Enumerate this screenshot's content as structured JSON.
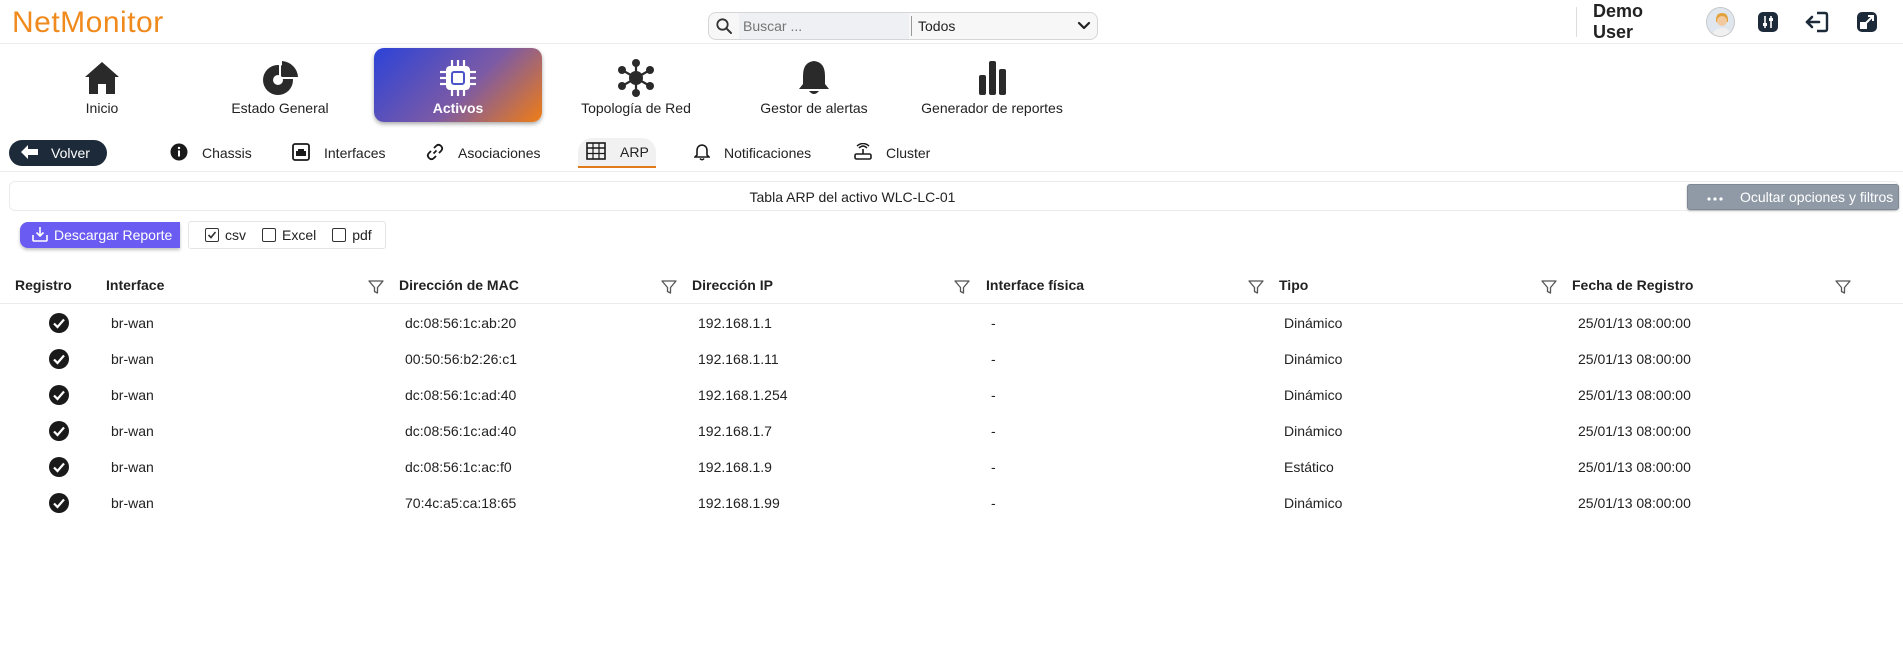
{
  "app": {
    "logo": "NetMonitor"
  },
  "search": {
    "placeholder": "Buscar ...",
    "scope_selected": "Todos"
  },
  "user": {
    "name": "Demo User"
  },
  "modules": [
    {
      "label": "Inicio",
      "icon": "home-icon"
    },
    {
      "label": "Estado General",
      "icon": "pie-chart-icon"
    },
    {
      "label": "Activos",
      "icon": "chip-icon",
      "active": true
    },
    {
      "label": "Topología de Red",
      "icon": "network-topology-icon"
    },
    {
      "label": "Gestor de alertas",
      "icon": "bell-icon"
    },
    {
      "label": "Generador de reportes",
      "icon": "bar-chart-icon"
    }
  ],
  "subnav": {
    "back_label": "Volver",
    "tabs": [
      {
        "label": "Chassis",
        "icon": "info-icon"
      },
      {
        "label": "Interfaces",
        "icon": "interface-icon"
      },
      {
        "label": "Asociaciones",
        "icon": "link-icon"
      },
      {
        "label": "ARP",
        "icon": "table-icon",
        "active": true
      },
      {
        "label": "Notificaciones",
        "icon": "bell-icon"
      },
      {
        "label": "Cluster",
        "icon": "router-icon"
      }
    ]
  },
  "panel": {
    "title": "Tabla ARP del activo WLC-LC-01",
    "toggle_label": "Ocultar opciones y filtros"
  },
  "report": {
    "download_label": "Descargar Reporte",
    "formats": [
      {
        "label": "csv",
        "checked": true
      },
      {
        "label": "Excel",
        "checked": false
      },
      {
        "label": "pdf",
        "checked": false
      }
    ]
  },
  "table": {
    "headers": [
      "Registro",
      "Interface",
      "Dirección de MAC",
      "Dirección IP",
      "Interface física",
      "Tipo",
      "Fecha de Registro"
    ],
    "rows": [
      {
        "interface": "br-wan",
        "mac": "dc:08:56:1c:ab:20",
        "ip": "192.168.1.1",
        "physical": "-",
        "type": "Dinámico",
        "date": "25/01/13 08:00:00"
      },
      {
        "interface": "br-wan",
        "mac": "00:50:56:b2:26:c1",
        "ip": "192.168.1.11",
        "physical": "-",
        "type": "Dinámico",
        "date": "25/01/13 08:00:00"
      },
      {
        "interface": "br-wan",
        "mac": "dc:08:56:1c:ad:40",
        "ip": "192.168.1.254",
        "physical": "-",
        "type": "Dinámico",
        "date": "25/01/13 08:00:00"
      },
      {
        "interface": "br-wan",
        "mac": "dc:08:56:1c:ad:40",
        "ip": "192.168.1.7",
        "physical": "-",
        "type": "Dinámico",
        "date": "25/01/13 08:00:00"
      },
      {
        "interface": "br-wan",
        "mac": "dc:08:56:1c:ac:f0",
        "ip": "192.168.1.9",
        "physical": "-",
        "type": "Estático",
        "date": "25/01/13 08:00:00"
      },
      {
        "interface": "br-wan",
        "mac": "70:4c:a5:ca:18:65",
        "ip": "192.168.1.99",
        "physical": "-",
        "type": "Dinámico",
        "date": "25/01/13 08:00:00"
      }
    ]
  },
  "colors": {
    "brand": "#f08a1c",
    "download": "#6a5cf2",
    "active_tab_underline": "#e07a1a"
  }
}
